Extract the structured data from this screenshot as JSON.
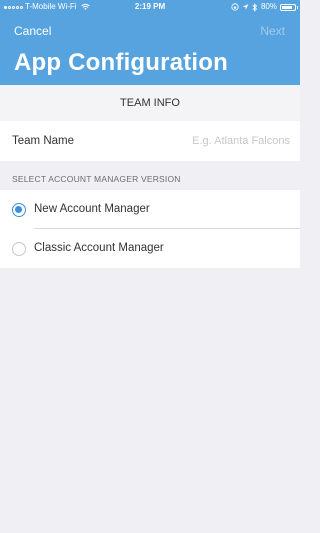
{
  "status_bar": {
    "carrier": "T-Mobile Wi-Fi",
    "time": "2:19 PM",
    "battery": "80%",
    "signal_bars_filled": 1,
    "signal_bars_total": 5,
    "battery_level_fraction": 0.8
  },
  "nav": {
    "cancel_label": "Cancel",
    "next_label": "Next",
    "title": "App Configuration"
  },
  "team_info": {
    "section_title": "TEAM INFO",
    "team_name_label": "Team Name",
    "team_name_placeholder": "E.g. Atlanta Falcons",
    "team_name_value": ""
  },
  "account_manager": {
    "group_label": "SELECT ACCOUNT MANAGER VERSION",
    "options": [
      {
        "label": "New Account Manager",
        "selected": true
      },
      {
        "label": "Classic Account Manager",
        "selected": false
      }
    ]
  },
  "colors": {
    "header": "#56a3e0",
    "accent": "#3d8fd8",
    "background": "#efeff4"
  }
}
